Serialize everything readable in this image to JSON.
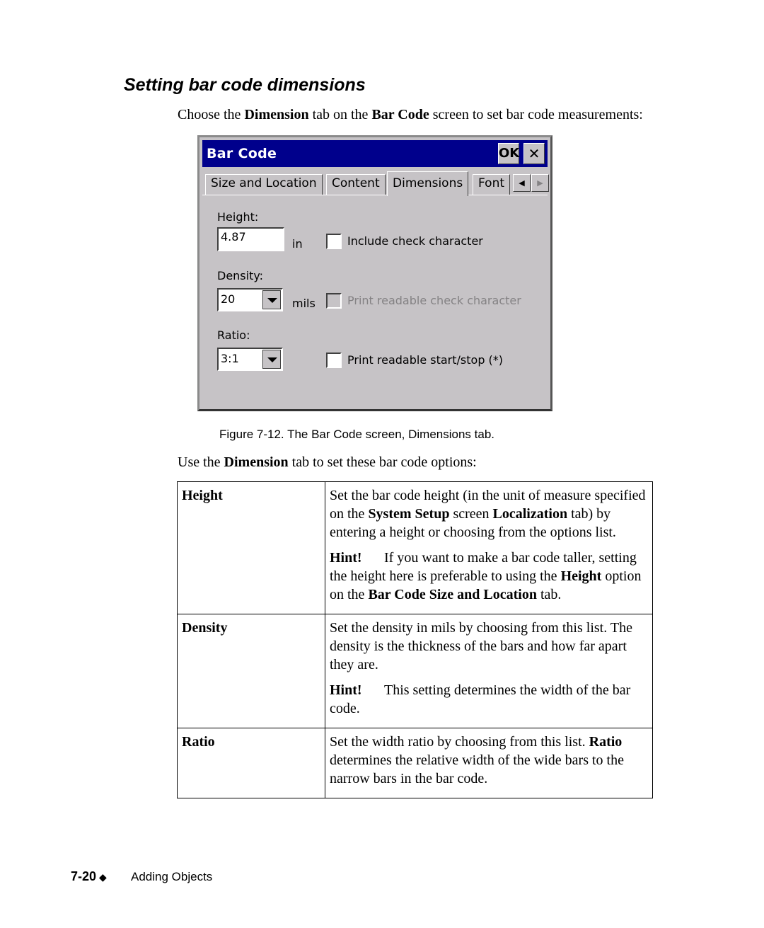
{
  "heading": "Setting bar code dimensions",
  "intro": {
    "p1": "Choose the ",
    "b1": "Dimension",
    "p2": " tab on the ",
    "b2": "Bar Code",
    "p3": " screen to set bar code measurements:"
  },
  "dialog": {
    "title": "Bar Code",
    "ok_label": "OK",
    "close_label": "✕",
    "tabs": [
      "Size and Location",
      "Content",
      "Dimensions",
      "Font"
    ],
    "active_tab": "Dimensions",
    "scroll_left": "◀",
    "scroll_right": "▶",
    "height_label": "Height:",
    "height_value": "4.87",
    "height_unit": "in",
    "density_label": "Density:",
    "density_value": "20",
    "density_unit": "mils",
    "ratio_label": "Ratio:",
    "ratio_value": "3:1",
    "checkboxes": [
      {
        "label": "Include check character",
        "checked": false,
        "enabled": true
      },
      {
        "label": "Print readable check character",
        "checked": false,
        "enabled": false
      },
      {
        "label": "Print readable start/stop (*)",
        "checked": false,
        "enabled": true
      }
    ]
  },
  "caption": "Figure 7-12. The Bar Code screen, Dimensions tab.",
  "lead": {
    "p1": "Use the ",
    "b1": "Dimension",
    "p2": " tab to set these bar code options:"
  },
  "options": [
    {
      "name": "Height",
      "desc": {
        "t1": "Set the bar code height (in the unit of measure specified on the ",
        "b1": "System Setup",
        "t2": " screen ",
        "b2": "Localization",
        "t3": " tab) by entering a height or choosing from the options list."
      },
      "hint": {
        "label": "Hint!",
        "t1": "If you want to make a bar code taller, setting the height here is preferable to using the ",
        "b1": "Height",
        "t2": " option on the ",
        "b2": "Bar Code Size and Location",
        "t3": " tab."
      }
    },
    {
      "name": "Density",
      "desc": {
        "t1": "Set the density in mils by choosing from this list. The density is the thickness of the bars and how far apart they are."
      },
      "hint": {
        "label": "Hint!",
        "t1": "This setting determines the width of the bar code."
      }
    },
    {
      "name": "Ratio",
      "desc": {
        "t1": "Set the width ratio by choosing from this list. ",
        "b1": "Ratio",
        "t2": " determines the relative width of the wide bars to the narrow bars in the bar code."
      }
    }
  ],
  "footer": {
    "page_number": "7-20",
    "diamond": "◆",
    "chapter": "Adding Objects"
  }
}
